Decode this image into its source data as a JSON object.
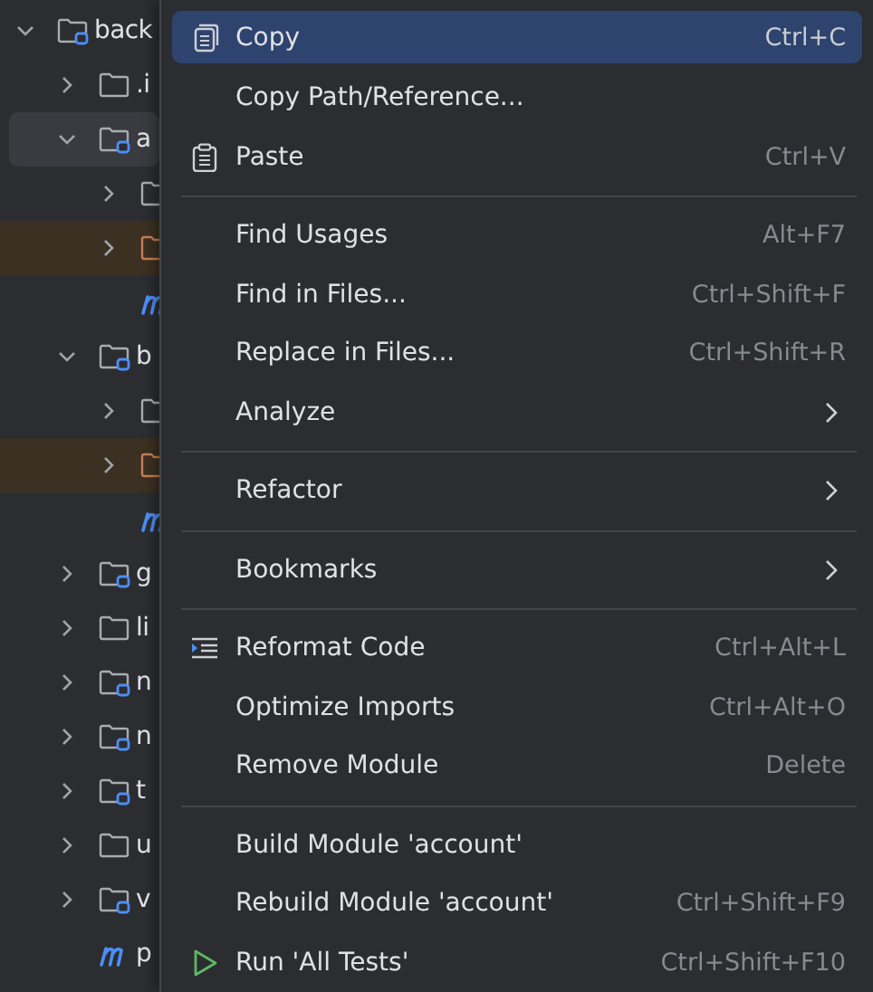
{
  "project_tree": [
    {
      "name": "back",
      "kind": "module",
      "expanded": true,
      "selected": false,
      "children": [
        {
          "name": ".i",
          "kind": "folder",
          "expanded": false,
          "selected": false
        },
        {
          "name": "a",
          "kind": "module",
          "expanded": true,
          "selected": true,
          "children": [
            {
              "kind": "folder",
              "expanded": false,
              "selected": false
            },
            {
              "kind": "excluded",
              "expanded": false,
              "selected": false
            },
            {
              "kind": "pom",
              "selected": false
            }
          ]
        },
        {
          "name": "b",
          "kind": "module",
          "expanded": true,
          "selected": false,
          "children": [
            {
              "kind": "folder",
              "expanded": false,
              "selected": false
            },
            {
              "kind": "excluded",
              "expanded": false,
              "selected": false
            },
            {
              "kind": "pom",
              "selected": false
            }
          ]
        },
        {
          "name": "g",
          "kind": "module",
          "expanded": false,
          "selected": false
        },
        {
          "name": "li",
          "kind": "folder",
          "expanded": false,
          "selected": false
        },
        {
          "name": "n",
          "kind": "module",
          "expanded": false,
          "selected": false
        },
        {
          "name": "n",
          "kind": "module",
          "expanded": false,
          "selected": false
        },
        {
          "name": "t",
          "kind": "module",
          "expanded": false,
          "selected": false
        },
        {
          "name": "u",
          "kind": "folder",
          "expanded": false,
          "selected": false
        },
        {
          "name": "v",
          "kind": "module",
          "expanded": false,
          "selected": false
        },
        {
          "name": "p",
          "kind": "pom",
          "selected": false
        }
      ]
    }
  ],
  "context_menu": [
    {
      "kind": "copy",
      "label": "Copy",
      "shortcut": "Ctrl+C",
      "selected": true
    },
    {
      "kind": "item",
      "label": "Copy Path/Reference...",
      "selected": false
    },
    {
      "kind": "paste",
      "label": "Paste",
      "shortcut": "Ctrl+V",
      "selected": false
    },
    {
      "kind": "separator"
    },
    {
      "kind": "item",
      "label": "Find Usages",
      "shortcut": "Alt+F7",
      "selected": false
    },
    {
      "kind": "item",
      "label": "Find in Files...",
      "shortcut": "Ctrl+Shift+F",
      "selected": false
    },
    {
      "kind": "item",
      "label": "Replace in Files...",
      "shortcut": "Ctrl+Shift+R",
      "selected": false
    },
    {
      "kind": "item",
      "label": "Analyze",
      "submenu": true,
      "selected": false
    },
    {
      "kind": "separator"
    },
    {
      "kind": "item",
      "label": "Refactor",
      "submenu": true,
      "selected": false
    },
    {
      "kind": "separator"
    },
    {
      "kind": "item",
      "label": "Bookmarks",
      "submenu": true,
      "selected": false
    },
    {
      "kind": "separator"
    },
    {
      "kind": "reformat",
      "label": "Reformat Code",
      "shortcut": "Ctrl+Alt+L",
      "selected": false
    },
    {
      "kind": "item",
      "label": "Optimize Imports",
      "shortcut": "Ctrl+Alt+O",
      "selected": false
    },
    {
      "kind": "item",
      "label": "Remove Module",
      "shortcut": "Delete",
      "selected": false
    },
    {
      "kind": "separator"
    },
    {
      "kind": "item",
      "label": "Build Module 'account'",
      "selected": false
    },
    {
      "kind": "item",
      "label": "Rebuild Module 'account'",
      "shortcut": "Ctrl+Shift+F9",
      "selected": false
    },
    {
      "kind": "run",
      "label": "Run 'All Tests'",
      "shortcut": "Ctrl+Shift+F10",
      "selected": false
    }
  ]
}
